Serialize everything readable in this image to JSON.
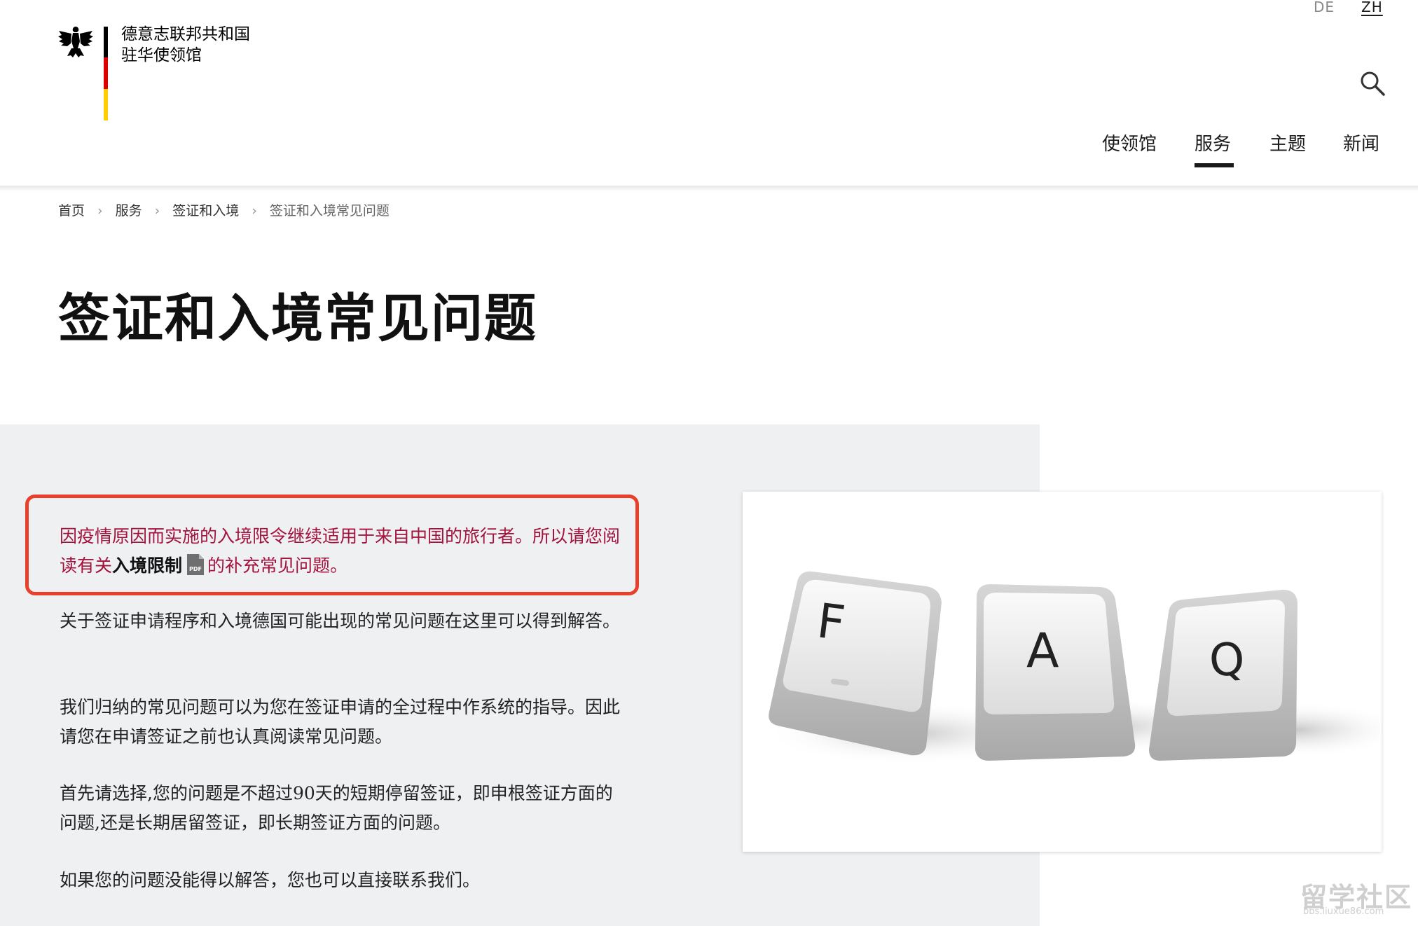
{
  "header": {
    "logo_line1": "德意志联邦共和国",
    "logo_line2": "驻华使领馆",
    "lang_de": "DE",
    "lang_zh": "ZH",
    "nav": [
      "使领馆",
      "服务",
      "主题",
      "新闻"
    ],
    "active_nav": "服务"
  },
  "breadcrumb": {
    "items": [
      "首页",
      "服务",
      "签证和入境",
      "签证和入境常见问题"
    ]
  },
  "page_title": "签证和入境常见问题",
  "notice": {
    "text_before": "因疫情原因而实施的入境限令继续适用于来自中国的旅行者。所以请您阅读有关",
    "link_text": "入境限制",
    "pdf_label": "PDF",
    "text_after": "的补充常见问题。"
  },
  "paragraphs": [
    "关于签证申请程序和入境德国可能出现的常见问题在这里可以得到解答。",
    "我们归纳的常见问题可以为您在签证申请的全过程中作系统的指导。因此请您在申请签证之前也认真阅读常见问题。",
    "首先请选择,您的问题是不超过90天的短期停留签证，即申根签证方面的问题,还是长期居留签证，即长期签证方面的问题。",
    "如果您的问题没能得以解答，您也可以直接联系我们。"
  ],
  "photo": {
    "keys": [
      "F",
      "A",
      "Q"
    ]
  },
  "watermark": {
    "main": "留学社区",
    "sub": "bbs.liuxue86.com"
  },
  "colors": {
    "notice_border": "#e8402a",
    "notice_text": "#a3133d",
    "panel_bg": "#eff0f2",
    "flag_black": "#000000",
    "flag_red": "#dd0000",
    "flag_gold": "#ffce00"
  }
}
